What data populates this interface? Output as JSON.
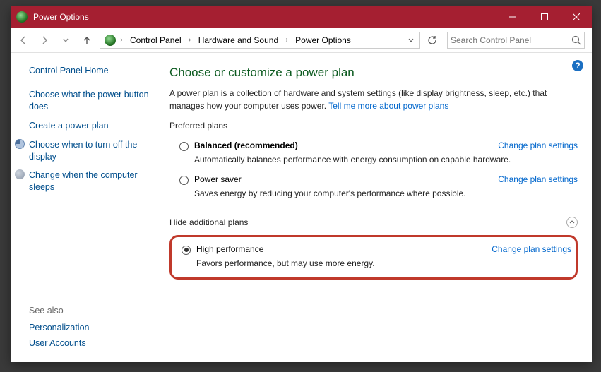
{
  "titlebar": {
    "title": "Power Options"
  },
  "breadcrumb": {
    "items": [
      "Control Panel",
      "Hardware and Sound",
      "Power Options"
    ]
  },
  "search": {
    "placeholder": "Search Control Panel"
  },
  "sidebar": {
    "heading": "Control Panel Home",
    "links": [
      {
        "label": "Choose what the power button does",
        "icon": ""
      },
      {
        "label": "Create a power plan",
        "icon": ""
      },
      {
        "label": "Choose when to turn off the display",
        "icon": "clock"
      },
      {
        "label": "Change when the computer sleeps",
        "icon": "moon"
      }
    ]
  },
  "seealso": {
    "heading": "See also",
    "items": [
      "Personalization",
      "User Accounts"
    ]
  },
  "main": {
    "title": "Choose or customize a power plan",
    "desc_prefix": "A power plan is a collection of hardware and system settings (like display brightness, sleep, etc.) that manages how your computer uses power. ",
    "learn_link": "Tell me more about power plans",
    "preferred_heading": "Preferred plans",
    "additional_heading": "Hide additional plans",
    "change_link": "Change plan settings",
    "plans": {
      "balanced": {
        "name": "Balanced (recommended)",
        "desc": "Automatically balances performance with energy consumption on capable hardware."
      },
      "saver": {
        "name": "Power saver",
        "desc": "Saves energy by reducing your computer's performance where possible."
      },
      "high": {
        "name": "High performance",
        "desc": "Favors performance, but may use more energy."
      }
    }
  }
}
